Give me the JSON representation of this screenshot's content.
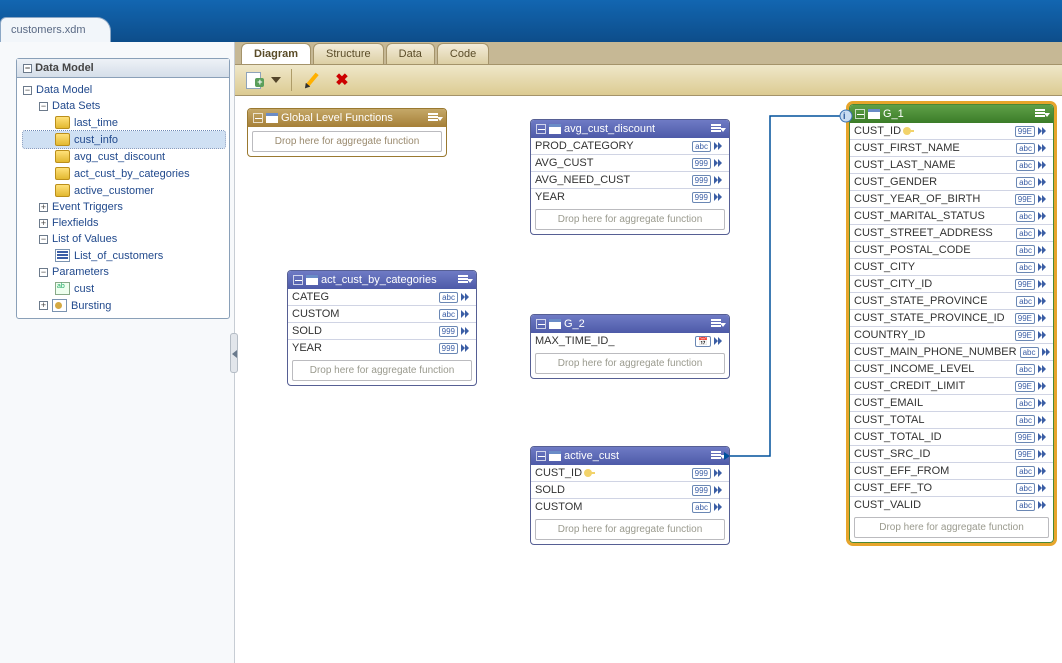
{
  "file_tab": "customers.xdm",
  "panel_title": "Data Model",
  "tree": {
    "root": "Data Model",
    "datasets_label": "Data Sets",
    "datasets": [
      "last_time",
      "cust_info",
      "avg_cust_discount",
      "act_cust_by_categories",
      "active_customer"
    ],
    "event_triggers": "Event Triggers",
    "flexfields": "Flexfields",
    "lov_label": "List of Values",
    "lov_items": [
      "List_of_customers"
    ],
    "params_label": "Parameters",
    "params": [
      "cust"
    ],
    "bursting": "Bursting"
  },
  "selected_tree_item": "cust_info",
  "sub_tabs": [
    "Diagram",
    "Structure",
    "Data",
    "Code"
  ],
  "active_sub_tab": "Diagram",
  "drop_text": "Drop here for aggregate function",
  "entities": {
    "global": {
      "title": "Global Level Functions"
    },
    "avg_cust_discount": {
      "title": "avg_cust_discount",
      "fields": [
        {
          "n": "PROD_CATEGORY",
          "t": "abc"
        },
        {
          "n": "AVG_CUST",
          "t": "999"
        },
        {
          "n": "AVG_NEED_CUST",
          "t": "999"
        },
        {
          "n": "YEAR",
          "t": "999"
        }
      ]
    },
    "act_cust_by_categories": {
      "title": "act_cust_by_categories",
      "fields": [
        {
          "n": "CATEG",
          "t": "abc"
        },
        {
          "n": "CUSTOM",
          "t": "abc"
        },
        {
          "n": "SOLD",
          "t": "999"
        },
        {
          "n": "YEAR",
          "t": "999"
        }
      ]
    },
    "g2": {
      "title": "G_2",
      "fields": [
        {
          "n": "MAX_TIME_ID_",
          "t": "cal"
        }
      ]
    },
    "active_cust": {
      "title": "active_cust",
      "fields": [
        {
          "n": "CUST_ID",
          "t": "999",
          "key": true
        },
        {
          "n": "SOLD",
          "t": "999"
        },
        {
          "n": "CUSTOM",
          "t": "abc"
        }
      ]
    },
    "g1": {
      "title": "G_1",
      "fields": [
        {
          "n": "CUST_ID",
          "t": "99E",
          "key": true
        },
        {
          "n": "CUST_FIRST_NAME",
          "t": "abc"
        },
        {
          "n": "CUST_LAST_NAME",
          "t": "abc"
        },
        {
          "n": "CUST_GENDER",
          "t": "abc"
        },
        {
          "n": "CUST_YEAR_OF_BIRTH",
          "t": "99E"
        },
        {
          "n": "CUST_MARITAL_STATUS",
          "t": "abc"
        },
        {
          "n": "CUST_STREET_ADDRESS",
          "t": "abc"
        },
        {
          "n": "CUST_POSTAL_CODE",
          "t": "abc"
        },
        {
          "n": "CUST_CITY",
          "t": "abc"
        },
        {
          "n": "CUST_CITY_ID",
          "t": "99E"
        },
        {
          "n": "CUST_STATE_PROVINCE",
          "t": "abc"
        },
        {
          "n": "CUST_STATE_PROVINCE_ID",
          "t": "99E"
        },
        {
          "n": "COUNTRY_ID",
          "t": "99E"
        },
        {
          "n": "CUST_MAIN_PHONE_NUMBER",
          "t": "abc"
        },
        {
          "n": "CUST_INCOME_LEVEL",
          "t": "abc"
        },
        {
          "n": "CUST_CREDIT_LIMIT",
          "t": "99E"
        },
        {
          "n": "CUST_EMAIL",
          "t": "abc"
        },
        {
          "n": "CUST_TOTAL",
          "t": "abc"
        },
        {
          "n": "CUST_TOTAL_ID",
          "t": "99E"
        },
        {
          "n": "CUST_SRC_ID",
          "t": "99E"
        },
        {
          "n": "CUST_EFF_FROM",
          "t": "abc"
        },
        {
          "n": "CUST_EFF_TO",
          "t": "abc"
        },
        {
          "n": "CUST_VALID",
          "t": "abc"
        }
      ]
    }
  }
}
